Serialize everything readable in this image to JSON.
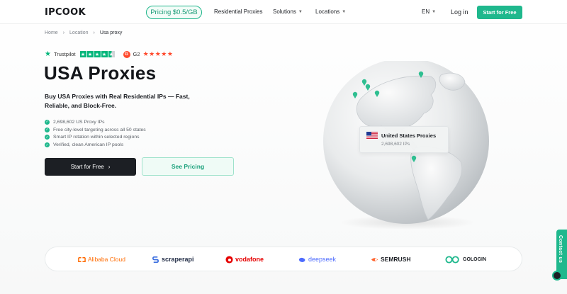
{
  "header": {
    "logo": "IPCOOK",
    "pricing_pill": "Pricing $0.5/GB",
    "nav": [
      "Residential Proxies",
      "Solutions",
      "Locations"
    ],
    "language": "EN",
    "login": "Log in",
    "start_button": "Start for Free"
  },
  "breadcrumb": [
    "Home",
    "Location",
    "Usa proxy"
  ],
  "ratings": {
    "trustpilot": "Trustpilot",
    "g2": "G2"
  },
  "hero": {
    "title": "USA Proxies",
    "subtitle": "Buy USA Proxies with Real Residential IPs — Fast, Reliable, and Block-Free.",
    "features": [
      "2,698,602 US Proxy IPs",
      "Free city-level targeting across all 50 states",
      "Smart IP rotation within selected regions",
      "Verified, clean American IP pools"
    ],
    "cta_primary": "Start for Free",
    "cta_secondary": "See Pricing"
  },
  "globe_tooltip": {
    "title": "United States Proxies",
    "subtitle": "2,698,602 IPs"
  },
  "partners": [
    "Alibaba Cloud",
    "scraperapi",
    "vodafone",
    "deepseek",
    "SEMRUSH",
    "GOLOGIN"
  ],
  "contact_tab": "Contact us",
  "colors": {
    "accent": "#1fb88d",
    "dark": "#1c1f24"
  }
}
